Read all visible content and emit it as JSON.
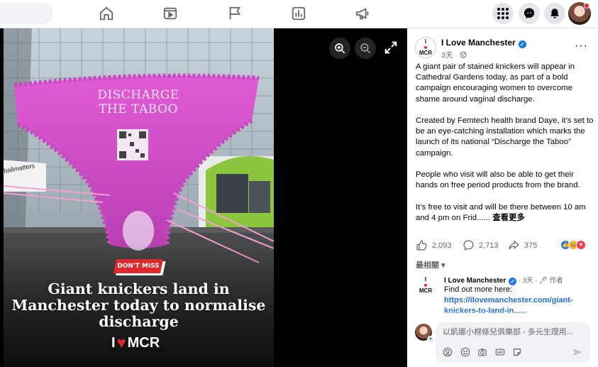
{
  "post": {
    "page_name": "I Love Manchester",
    "time": "3天 · ",
    "more": "···",
    "paragraphs": [
      "A giant pair of stained knickers will appear in Cathedral Gardens today, as part of a bold campaign encouraging women to overcome shame around vaginal discharge.",
      "Created by Femtech health brand Daye, it’s set to be an eye-catching installation which marks the launch of its national “Discharge the Taboo” campaign.",
      "People who visit will also be able to get their hands on free period products from the brand."
    ],
    "last_paragraph": "It’s free to visit and will be there between 10 am and 4 pm on Frid...... ",
    "see_more": "查看更多",
    "likes": "2,093",
    "comments": "2,713",
    "shares": "375"
  },
  "photo": {
    "knicker_text": "DISCHARGE\nTHE TABOO",
    "sign_text": "ballmatters",
    "tag": "DON'T MISS",
    "headline": "Giant knickers land in Manchester today to normalise discharge",
    "logo_text": "MCR",
    "logo_i": "I"
  },
  "comments": {
    "sort_label": "最相關 ▾",
    "author": "I Love Manchester",
    "meta": " · 3天 · 🖊 作者",
    "text": "Find out more here:",
    "link": "https://ilovemanchester.com/giant-knickers-to-land-in......",
    "input_placeholder": "以凱娜小棉條兒俱樂部 - 多元生理用..."
  },
  "avatar_text": {
    "top": "I",
    "heart": "♥",
    "bottom": "MCR"
  },
  "colors": {
    "facebook_blue": "#1877f2",
    "knicker_pink": "#d84fcf",
    "brand_red": "#e0282c",
    "link": "#216fdb"
  },
  "icons": [
    "home-icon",
    "watch-icon",
    "flag-icon",
    "chart-icon",
    "megaphone-icon",
    "menu-grid-icon",
    "messenger-icon",
    "bell-icon",
    "zoom-in-icon",
    "zoom-out-icon",
    "expand-icon",
    "like-icon",
    "comment-icon",
    "share-icon",
    "globe-icon"
  ]
}
